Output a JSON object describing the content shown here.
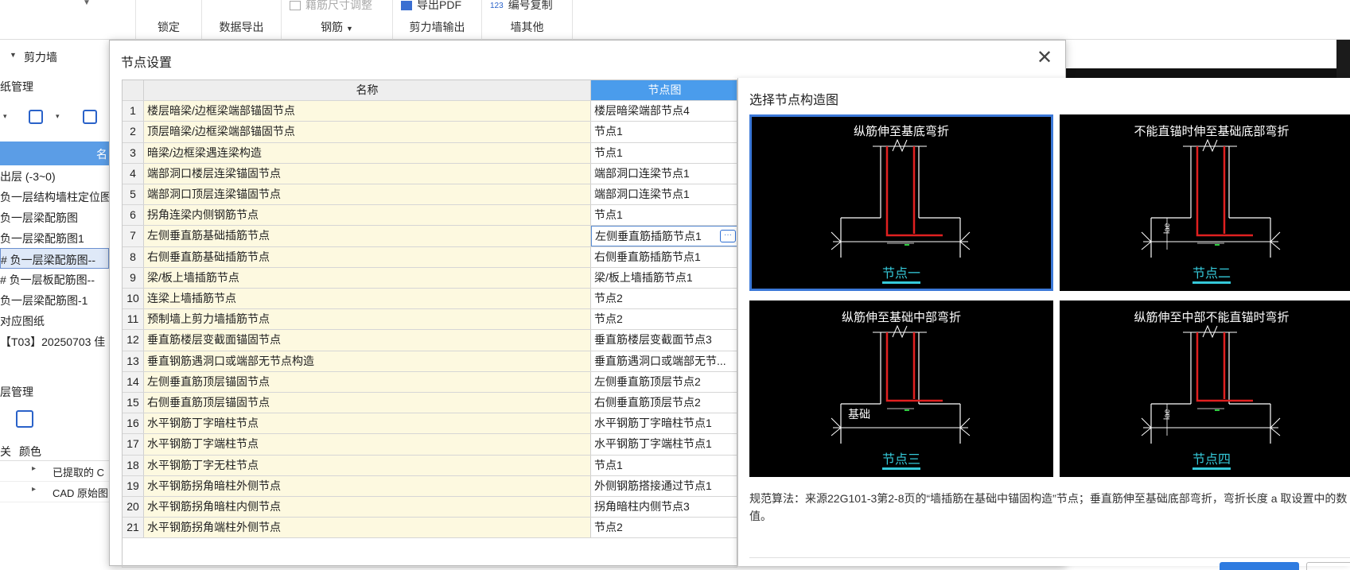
{
  "ribbon": {
    "lock_label": "锁定",
    "export_label": "数据导出",
    "rebar_label": "钢筋",
    "shearwall_output_label": "剪力墙输出",
    "wall_other_label": "墙其他",
    "adjust_dim_label": "籍筋尺寸调整",
    "export_pdf_label": "导出PDF",
    "number_copy_label": "编号复制"
  },
  "left": {
    "combo_value": "剪力墙",
    "drawing_mgmt_label": "纸管理",
    "col_header": "名",
    "tree": [
      {
        "label": "出层 (-3~0)",
        "selected": false
      },
      {
        "label": "负一层结构墙柱定位图",
        "selected": false
      },
      {
        "label": "负一层梁配筋图",
        "selected": false
      },
      {
        "label": "负一层梁配筋图1",
        "selected": false
      },
      {
        "label": "# 负一层梁配筋图--",
        "selected": true
      },
      {
        "label": "# 负一层板配筋图--",
        "selected": false
      },
      {
        "label": "负一层梁配筋图-1",
        "selected": false
      },
      {
        "label": "对应图纸",
        "selected": false
      },
      {
        "label": "【T03】20250703 佳",
        "selected": false
      }
    ],
    "layer_mgmt_label": "层管理",
    "layer_col1": "关",
    "layer_col2": "颜色",
    "layers": [
      {
        "label": "已提取的 C"
      },
      {
        "label": "CAD 原始图"
      }
    ]
  },
  "dialog": {
    "title": "节点设置",
    "close_icon": "close-icon",
    "grid": {
      "headers": [
        "名称",
        "节点图"
      ],
      "rows": [
        {
          "num": "1",
          "name": "楼层暗梁/边框梁端部锚固节点",
          "node": "楼层暗梁端部节点4"
        },
        {
          "num": "2",
          "name": "顶层暗梁/边框梁端部锚固节点",
          "node": "节点1"
        },
        {
          "num": "3",
          "name": "暗梁/边框梁遇连梁构造",
          "node": "节点1"
        },
        {
          "num": "4",
          "name": "端部洞口楼层连梁锚固节点",
          "node": "端部洞口连梁节点1"
        },
        {
          "num": "5",
          "name": "端部洞口顶层连梁锚固节点",
          "node": "端部洞口连梁节点1"
        },
        {
          "num": "6",
          "name": "拐角连梁内侧钢筋节点",
          "node": "节点1"
        },
        {
          "num": "7",
          "name": "左侧垂直筋基础插筋节点",
          "node": "左侧垂直筋插筋节点1"
        },
        {
          "num": "8",
          "name": "右侧垂直筋基础插筋节点",
          "node": "右侧垂直筋插筋节点1"
        },
        {
          "num": "9",
          "name": "梁/板上墙插筋节点",
          "node": "梁/板上墙插筋节点1"
        },
        {
          "num": "10",
          "name": "连梁上墙插筋节点",
          "node": "节点2"
        },
        {
          "num": "11",
          "name": "预制墙上剪力墙插筋节点",
          "node": "节点2"
        },
        {
          "num": "12",
          "name": "垂直筋楼层变截面锚固节点",
          "node": "垂直筋楼层变截面节点3"
        },
        {
          "num": "13",
          "name": "垂直钢筋遇洞口或端部无节点构造",
          "node": "垂直筋遇洞口或端部无节..."
        },
        {
          "num": "14",
          "name": "左侧垂直筋顶层锚固节点",
          "node": "左侧垂直筋顶层节点2"
        },
        {
          "num": "15",
          "name": "右侧垂直筋顶层锚固节点",
          "node": "右侧垂直筋顶层节点2"
        },
        {
          "num": "16",
          "name": "水平钢筋丁字暗柱节点",
          "node": "水平钢筋丁字暗柱节点1"
        },
        {
          "num": "17",
          "name": "水平钢筋丁字端柱节点",
          "node": "水平钢筋丁字端柱节点1"
        },
        {
          "num": "18",
          "name": "水平钢筋丁字无柱节点",
          "node": "节点1"
        },
        {
          "num": "19",
          "name": "水平钢筋拐角暗柱外侧节点",
          "node": "外侧钢筋搭接通过节点1"
        },
        {
          "num": "20",
          "name": "水平钢筋拐角暗柱内侧节点",
          "node": "拐角暗柱内侧节点3"
        },
        {
          "num": "21",
          "name": "水平钢筋拐角端柱外侧节点",
          "node": "节点2"
        }
      ],
      "active_row": 7,
      "more_label": "···"
    }
  },
  "side": {
    "title": "选择节点构造图",
    "diagrams": [
      {
        "caption": "纵筋伸至基底弯折",
        "label": "节点一",
        "selected": true
      },
      {
        "caption": "不能直锚时伸至基础底部弯折",
        "label": "节点二",
        "selected": false
      },
      {
        "caption": "纵筋伸至基础中部弯折",
        "label": "节点三",
        "selected": false,
        "extra": "基础"
      },
      {
        "caption": "纵筋伸至中部不能直锚时弯折",
        "label": "节点四",
        "selected": false
      }
    ],
    "description": "规范算法：来源22G101-3第2-8页的“墙插筋在基础中锚固构造”节点；垂直筋伸至基础底部弯折，弯折长度 a 取设置中的数值。"
  }
}
